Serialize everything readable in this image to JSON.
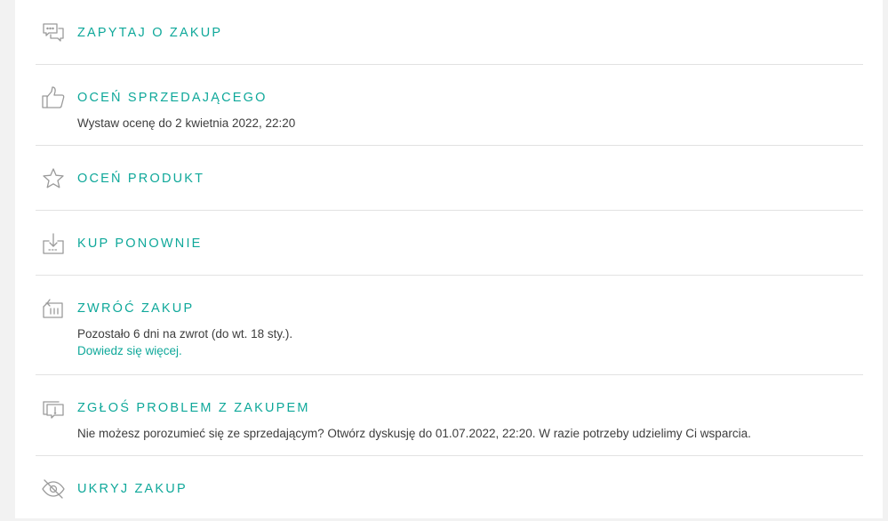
{
  "actions": {
    "ask": {
      "title": "ZAPYTAJ O ZAKUP",
      "icon": "chat-icon"
    },
    "rate_seller": {
      "title": "OCEŃ SPRZEDAJĄCEGO",
      "description": "Wystaw ocenę do 2 kwietnia 2022, 22:20",
      "icon": "thumbs-up-icon"
    },
    "rate_product": {
      "title": "OCEŃ PRODUKT",
      "icon": "star-icon"
    },
    "buy_again": {
      "title": "KUP PONOWNIE",
      "icon": "basket-download-icon"
    },
    "return": {
      "title": "ZWRÓĆ ZAKUP",
      "description": "Pozostało 6 dni na zwrot (do wt. 18 sty.).",
      "link": "Dowiedz się więcej.",
      "icon": "return-package-icon"
    },
    "report": {
      "title": "ZGŁOŚ PROBLEM Z ZAKUPEM",
      "description": "Nie możesz porozumieć się ze sprzedającym? Otwórz dyskusję do 01.07.2022, 22:20. W razie potrzeby udzielimy Ci wsparcia.",
      "icon": "report-problem-icon"
    },
    "hide": {
      "title": "UKRYJ ZAKUP",
      "icon": "eye-off-icon"
    }
  },
  "colors": {
    "accent": "#0fa89a",
    "text": "#3d3d3d",
    "icon": "#9a9a9a",
    "divider": "#e2e2e2",
    "background": "#f2f2f2"
  }
}
